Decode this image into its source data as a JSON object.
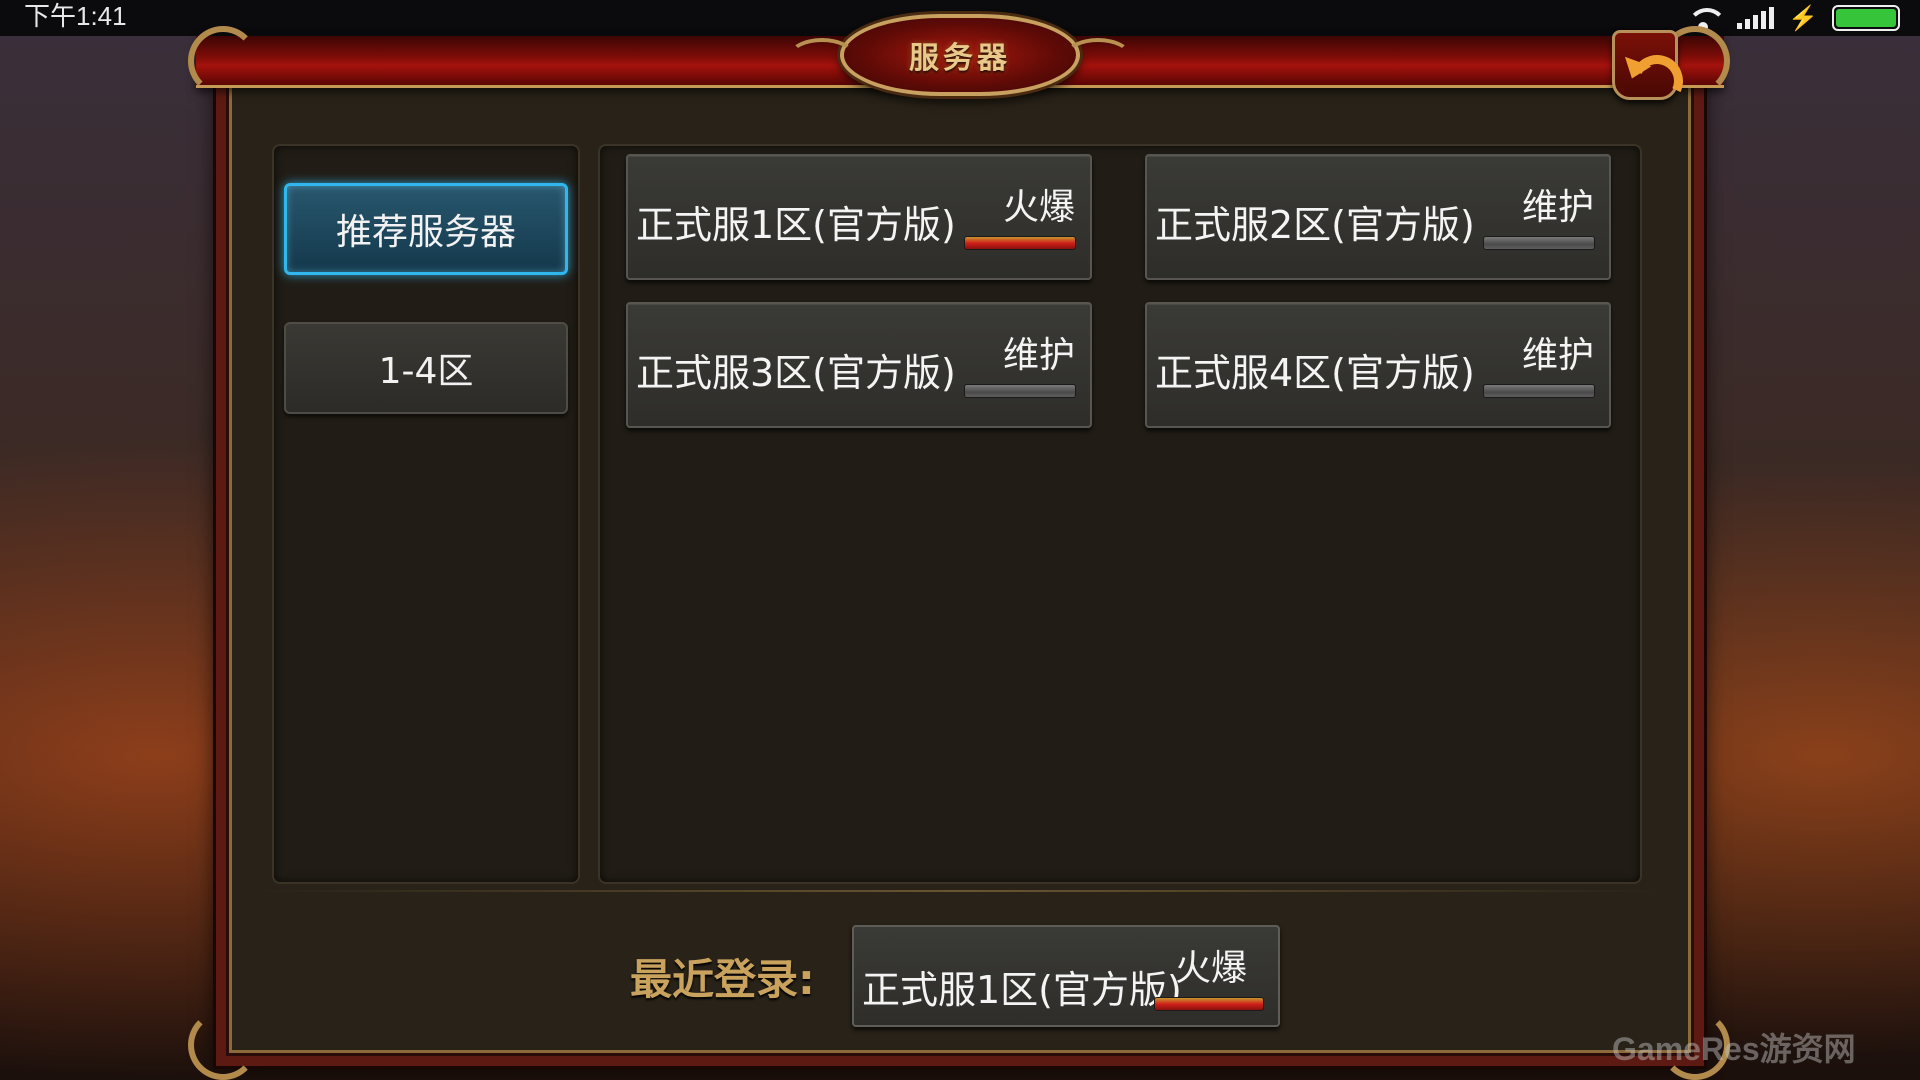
{
  "status_bar": {
    "time": "下午1:41"
  },
  "window": {
    "title": "服务器"
  },
  "categories": [
    {
      "label": "推荐服务器",
      "active": true
    },
    {
      "label": "1-4区",
      "active": false
    }
  ],
  "servers": [
    {
      "name": "正式服1区(官方版)",
      "status": "火爆",
      "status_type": "hot"
    },
    {
      "name": "正式服2区(官方版)",
      "status": "维护",
      "status_type": "maintenance"
    },
    {
      "name": "正式服3区(官方版)",
      "status": "维护",
      "status_type": "maintenance"
    },
    {
      "name": "正式服4区(官方版)",
      "status": "维护",
      "status_type": "maintenance"
    }
  ],
  "recent": {
    "label": "最近登录:",
    "server_name": "正式服1区(官方版)",
    "status": "火爆",
    "status_type": "hot"
  },
  "watermark": "GameRes游资网",
  "colors": {
    "active_category_border": "#2fb7ee",
    "hot_status": "#d0201a",
    "maintenance_status": "#5e5e5e",
    "recent_label": "#c9a35e"
  }
}
